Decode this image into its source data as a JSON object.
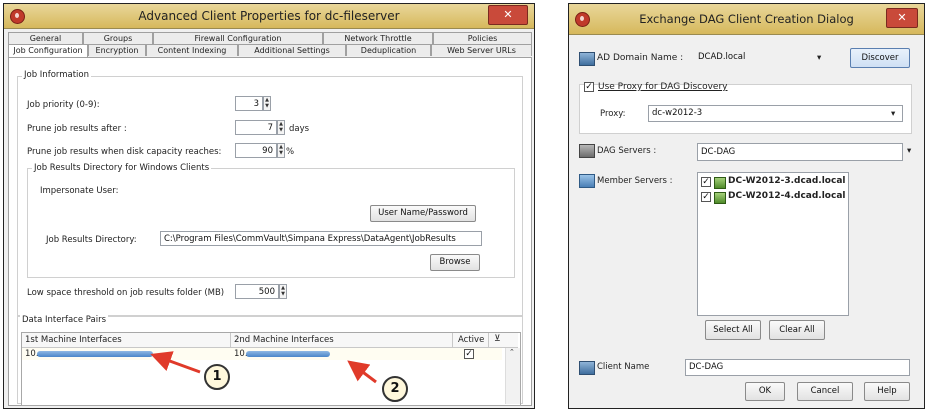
{
  "left_window": {
    "title": "Advanced Client Properties for dc-fileserver",
    "tabs_row1": [
      "General",
      "Groups",
      "Firewall Configuration",
      "Network Throttle",
      "Policies"
    ],
    "tabs_row2": [
      "Job Configuration",
      "Encryption",
      "Content Indexing",
      "Additional Settings",
      "Deduplication",
      "Web Server URLs"
    ],
    "active_tab": "Job Configuration",
    "job_info_title": "Job Information",
    "job_priority_label": "Job priority (0-9):",
    "job_priority_value": "3",
    "prune_after_label": "Prune job results after :",
    "prune_after_value": "7",
    "prune_after_unit": "days",
    "prune_disk_label": "Prune job results when disk capacity reaches:",
    "prune_disk_value": "90",
    "prune_disk_unit": "%",
    "results_dir_group_title": "Job Results Directory for Windows Clients",
    "impersonate_label": "Impersonate User:",
    "user_pass_button": "User Name/Password",
    "results_dir_label": "Job Results Directory:",
    "results_dir_value": "C:\\Program Files\\CommVault\\Simpana Express\\DataAgent\\JobResults",
    "browse_button": "Browse",
    "low_space_label": "Low space threshold on job results folder (MB)",
    "low_space_value": "500",
    "data_pairs_title": "Data Interface Pairs",
    "col_1st": "1st Machine Interfaces",
    "col_2nd": "2nd Machine Interfaces",
    "col_active": "Active",
    "row_1st_prefix": "10.",
    "row_2nd_prefix": "10.",
    "callout_1": "1",
    "callout_2": "2"
  },
  "right_window": {
    "title": "Exchange DAG Client Creation Dialog",
    "ad_domain_label": "AD Domain Name :",
    "ad_domain_value": "DCAD.local",
    "discover_button": "Discover",
    "use_proxy_label": "Use Proxy for DAG Discovery",
    "proxy_label": "Proxy:",
    "proxy_value": "dc-w2012-3",
    "dag_servers_label": "DAG Servers :",
    "dag_servers_value": "DC-DAG",
    "member_servers_label": "Member Servers :",
    "member_servers": [
      "DC-W2012-3.dcad.local",
      "DC-W2012-4.dcad.local"
    ],
    "select_all_button": "Select All",
    "clear_all_button": "Clear All",
    "client_name_label": "Client Name",
    "client_name_value": "DC-DAG",
    "ok_button": "OK",
    "cancel_button": "Cancel",
    "help_button": "Help"
  },
  "colors": {
    "titlebar": "#d6b85c",
    "close_button": "#c94a3a",
    "redaction_bar": "#4a86c9",
    "arrow": "#e03a2a"
  }
}
